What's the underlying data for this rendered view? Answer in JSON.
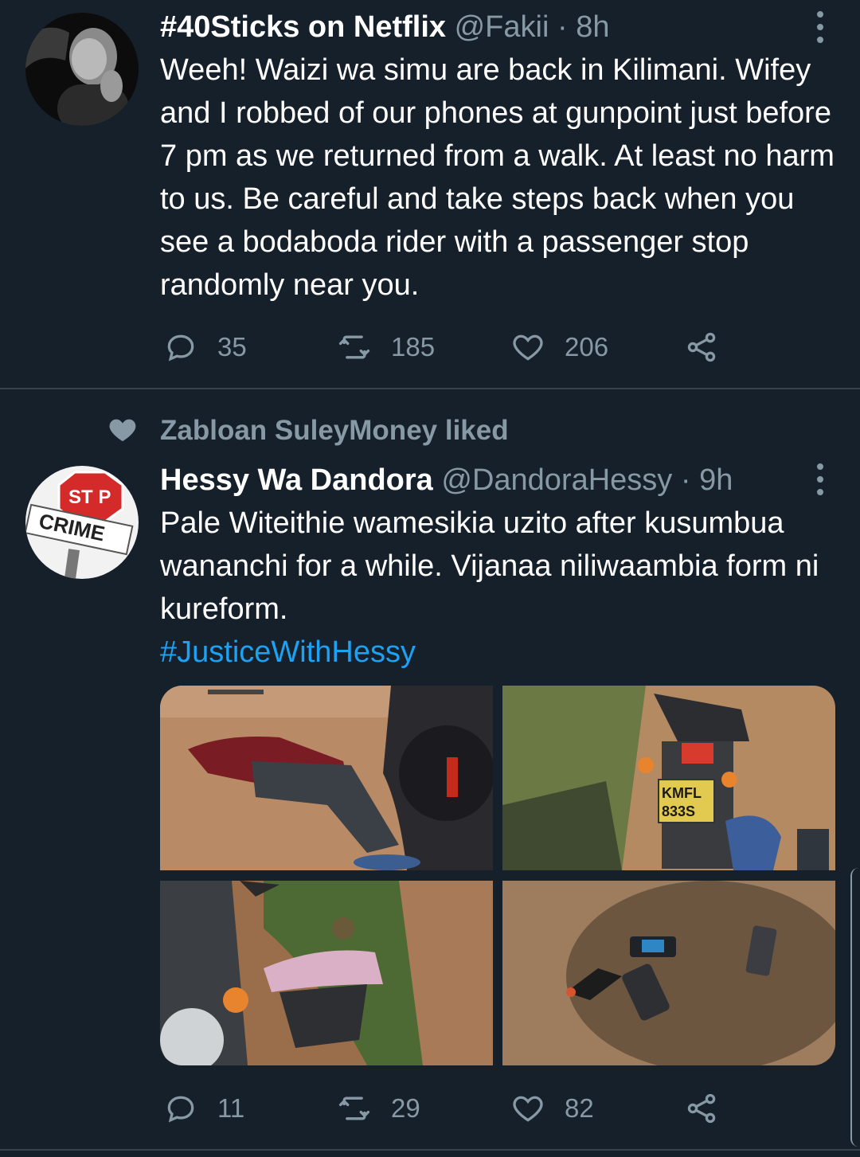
{
  "tweets": [
    {
      "name": "#40Sticks on Netflix",
      "handle": "@Fakii",
      "separator": "·",
      "time": "8h",
      "text": "Weeh! Waizi wa simu are back in Kilimani. Wifey and I robbed of our phones at gunpoint just before 7 pm as we returned from a walk. At least no harm to us. Be careful and take steps back when you see a bodaboda rider with a passenger stop randomly near you.",
      "replies": "35",
      "retweets": "185",
      "likes": "206"
    },
    {
      "liked_by": "Zabloan SuleyMoney liked",
      "name": "Hessy Wa Dandora",
      "handle": "@DandoraHessy",
      "separator": "·",
      "time": "9h",
      "text": "Pale Witeithie wamesikia uzito after kusumbua wananchi for a while. Vijanaa niliwaambia form ni kureform.",
      "hashtag": "#JusticeWithHessy",
      "avatar_sign_text": "ST P",
      "avatar_board_text": "CRIME",
      "plate_top": "KMFL",
      "plate_bottom": "833S",
      "replies": "11",
      "retweets": "29",
      "likes": "82"
    }
  ],
  "colors": {
    "background": "#15202b",
    "secondary_text": "#8899a6",
    "link": "#1da1f2",
    "divider": "#38444d"
  },
  "icons": [
    "reply-icon",
    "retweet-icon",
    "like-icon",
    "share-icon",
    "more-icon",
    "heart-icon"
  ]
}
